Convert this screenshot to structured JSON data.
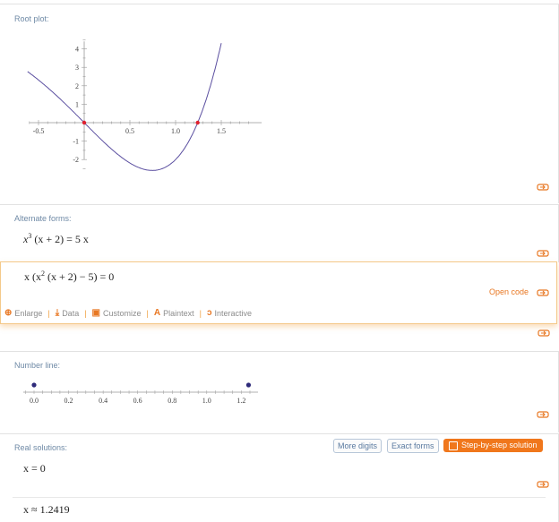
{
  "root_plot": {
    "title": "Root plot:",
    "chart_data": {
      "type": "line",
      "x_ticks": [
        "-0.5",
        "0.5",
        "1.0",
        "1.5"
      ],
      "y_ticks": [
        "4",
        "3",
        "2",
        "1",
        "-1",
        "-2"
      ],
      "xlim": [
        -0.6,
        1.55
      ],
      "ylim": [
        -2.5,
        4.5
      ],
      "function": "x^4 + 2x^3 - 5x",
      "roots": [
        0,
        1.2419
      ]
    }
  },
  "alternate_forms": {
    "title": "Alternate forms:",
    "form1": {
      "lhs_a": "x",
      "sup": "3",
      "lhs_b": " (x + 2) = 5 x"
    },
    "form2": {
      "a": "x (x",
      "sup": "2",
      "b": " (x + 2) − 5) = 0"
    }
  },
  "toolbar": {
    "open_code": "Open code",
    "enlarge": "Enlarge",
    "data": "Data",
    "customize": "Customize",
    "plaintext": "Plaintext",
    "interactive": "Interactive"
  },
  "number_line": {
    "title": "Number line:",
    "chart_data": {
      "type": "scatter",
      "x_ticks": [
        "0.0",
        "0.2",
        "0.4",
        "0.6",
        "0.8",
        "1.0",
        "1.2"
      ],
      "points": [
        0.0,
        1.2419
      ],
      "xlim": [
        -0.05,
        1.32
      ]
    }
  },
  "real_solutions": {
    "title": "Real solutions:",
    "more_digits": "More digits",
    "exact_forms": "Exact forms",
    "step_by_step": "Step-by-step solution",
    "sol1": "x = 0",
    "sol2": "x ≈ 1.2419"
  },
  "colors": {
    "accent": "#e87722",
    "curve": "#5b4fa0",
    "root": "#e0202e",
    "title": "#6f8aa6"
  }
}
